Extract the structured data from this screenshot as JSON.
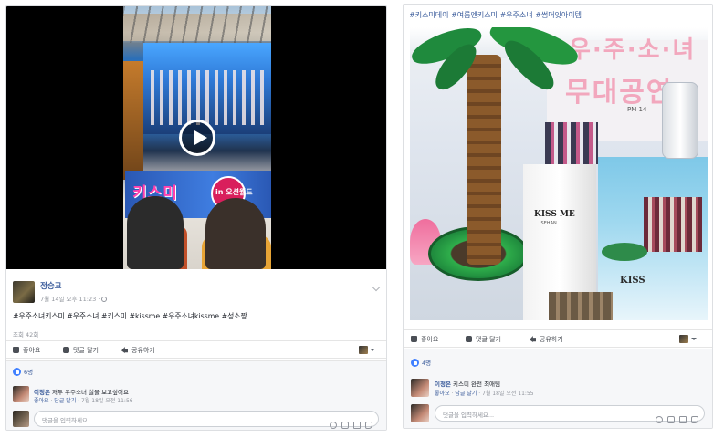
{
  "left_post": {
    "author": "정승교",
    "meta": "7월 14일 오후 11:23 ·",
    "caption": "#우주소녀키스미 #우주소녀 #키스미 #kissme #우주소녀kissme #성소짱",
    "views": "조회 42회",
    "video_banner_text": "키스미",
    "video_badge_text": "in 오션월드",
    "actions": {
      "like": "좋아요",
      "comment": "댓글 달기",
      "share": "공유하기"
    },
    "reactions_count": "6명",
    "comment": {
      "author": "이정은",
      "text": "저두 우주소녀 실물 보고싶어요",
      "links": [
        "좋아요",
        "답글 달기"
      ],
      "time": "7월 18일 오전 11:56"
    },
    "comment_placeholder": "댓글을 입력하세요..."
  },
  "right_post": {
    "hashtags": "#키스미데이 #여름엔키스미 #우주소녀 #썸머잇아이템",
    "photo_sign_line1": "우·주·소·녀",
    "photo_sign_line2": "무대공연",
    "photo_clock": "PM 14",
    "photo_logo": "KISS ME",
    "photo_logo_sub": "ISEHAN",
    "photo_logo_right": "KISS",
    "actions": {
      "like": "좋아요",
      "comment": "댓글 달기",
      "share": "공유하기"
    },
    "reactions_count": "4명",
    "comment": {
      "author": "이정은",
      "text": "키스미 완전 최애템",
      "links": [
        "좋아요",
        "답글 달기"
      ],
      "time": "7월 18일 오전 11:55"
    },
    "comment_placeholder": "댓글을 입력하세요..."
  },
  "colors": {
    "link": "#365899",
    "like_badge": "#4080ff",
    "muted": "#90949c",
    "border": "#dddfe2"
  },
  "icons": [
    "play-icon",
    "globe-icon",
    "thumbs-up-icon",
    "comment-icon",
    "share-icon",
    "emoji-icon",
    "camera-icon",
    "gif-icon",
    "sticker-icon"
  ]
}
